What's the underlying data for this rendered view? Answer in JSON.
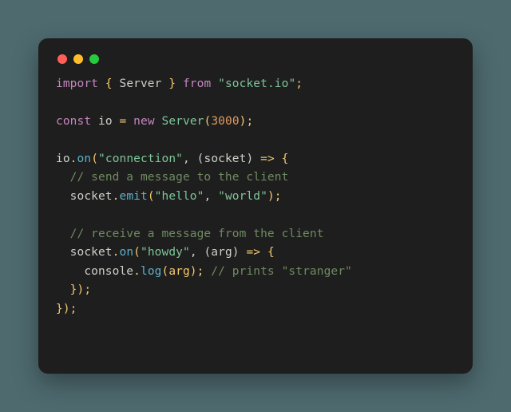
{
  "window": {
    "traffic_lights": {
      "close": "#ff5f56",
      "minimize": "#ffbd2e",
      "zoom": "#27c93f"
    }
  },
  "code": {
    "l1": {
      "a": "import",
      "b": " { ",
      "c": "Server",
      "d": " } ",
      "e": "from",
      "f": " ",
      "g": "\"socket.io\"",
      "h": ";"
    },
    "l2": "",
    "l3": {
      "a": "const",
      "b": " io ",
      "c": "=",
      "d": " ",
      "e": "new",
      "f": " ",
      "g": "Server",
      "h": "(",
      "i": "3000",
      "j": ");"
    },
    "l4": "",
    "l5": {
      "a": "io",
      "b": ".",
      "c": "on",
      "d": "(",
      "e": "\"connection\"",
      "f": ", (socket) ",
      "g": "=>",
      "h": " {"
    },
    "l6": {
      "a": "  ",
      "b": "// send a message to the client"
    },
    "l7": {
      "a": "  socket",
      "b": ".",
      "c": "emit",
      "d": "(",
      "e": "\"hello\"",
      "f": ", ",
      "g": "\"world\"",
      "h": ");"
    },
    "l8": "",
    "l9": {
      "a": "  ",
      "b": "// receive a message from the client"
    },
    "l10": {
      "a": "  socket",
      "b": ".",
      "c": "on",
      "d": "(",
      "e": "\"howdy\"",
      "f": ", (arg) ",
      "g": "=>",
      "h": " {"
    },
    "l11": {
      "a": "    console",
      "b": ".",
      "c": "log",
      "d": "(arg); ",
      "e": "// prints \"stranger\""
    },
    "l12": {
      "a": "  });"
    },
    "l13": {
      "a": "});"
    }
  }
}
